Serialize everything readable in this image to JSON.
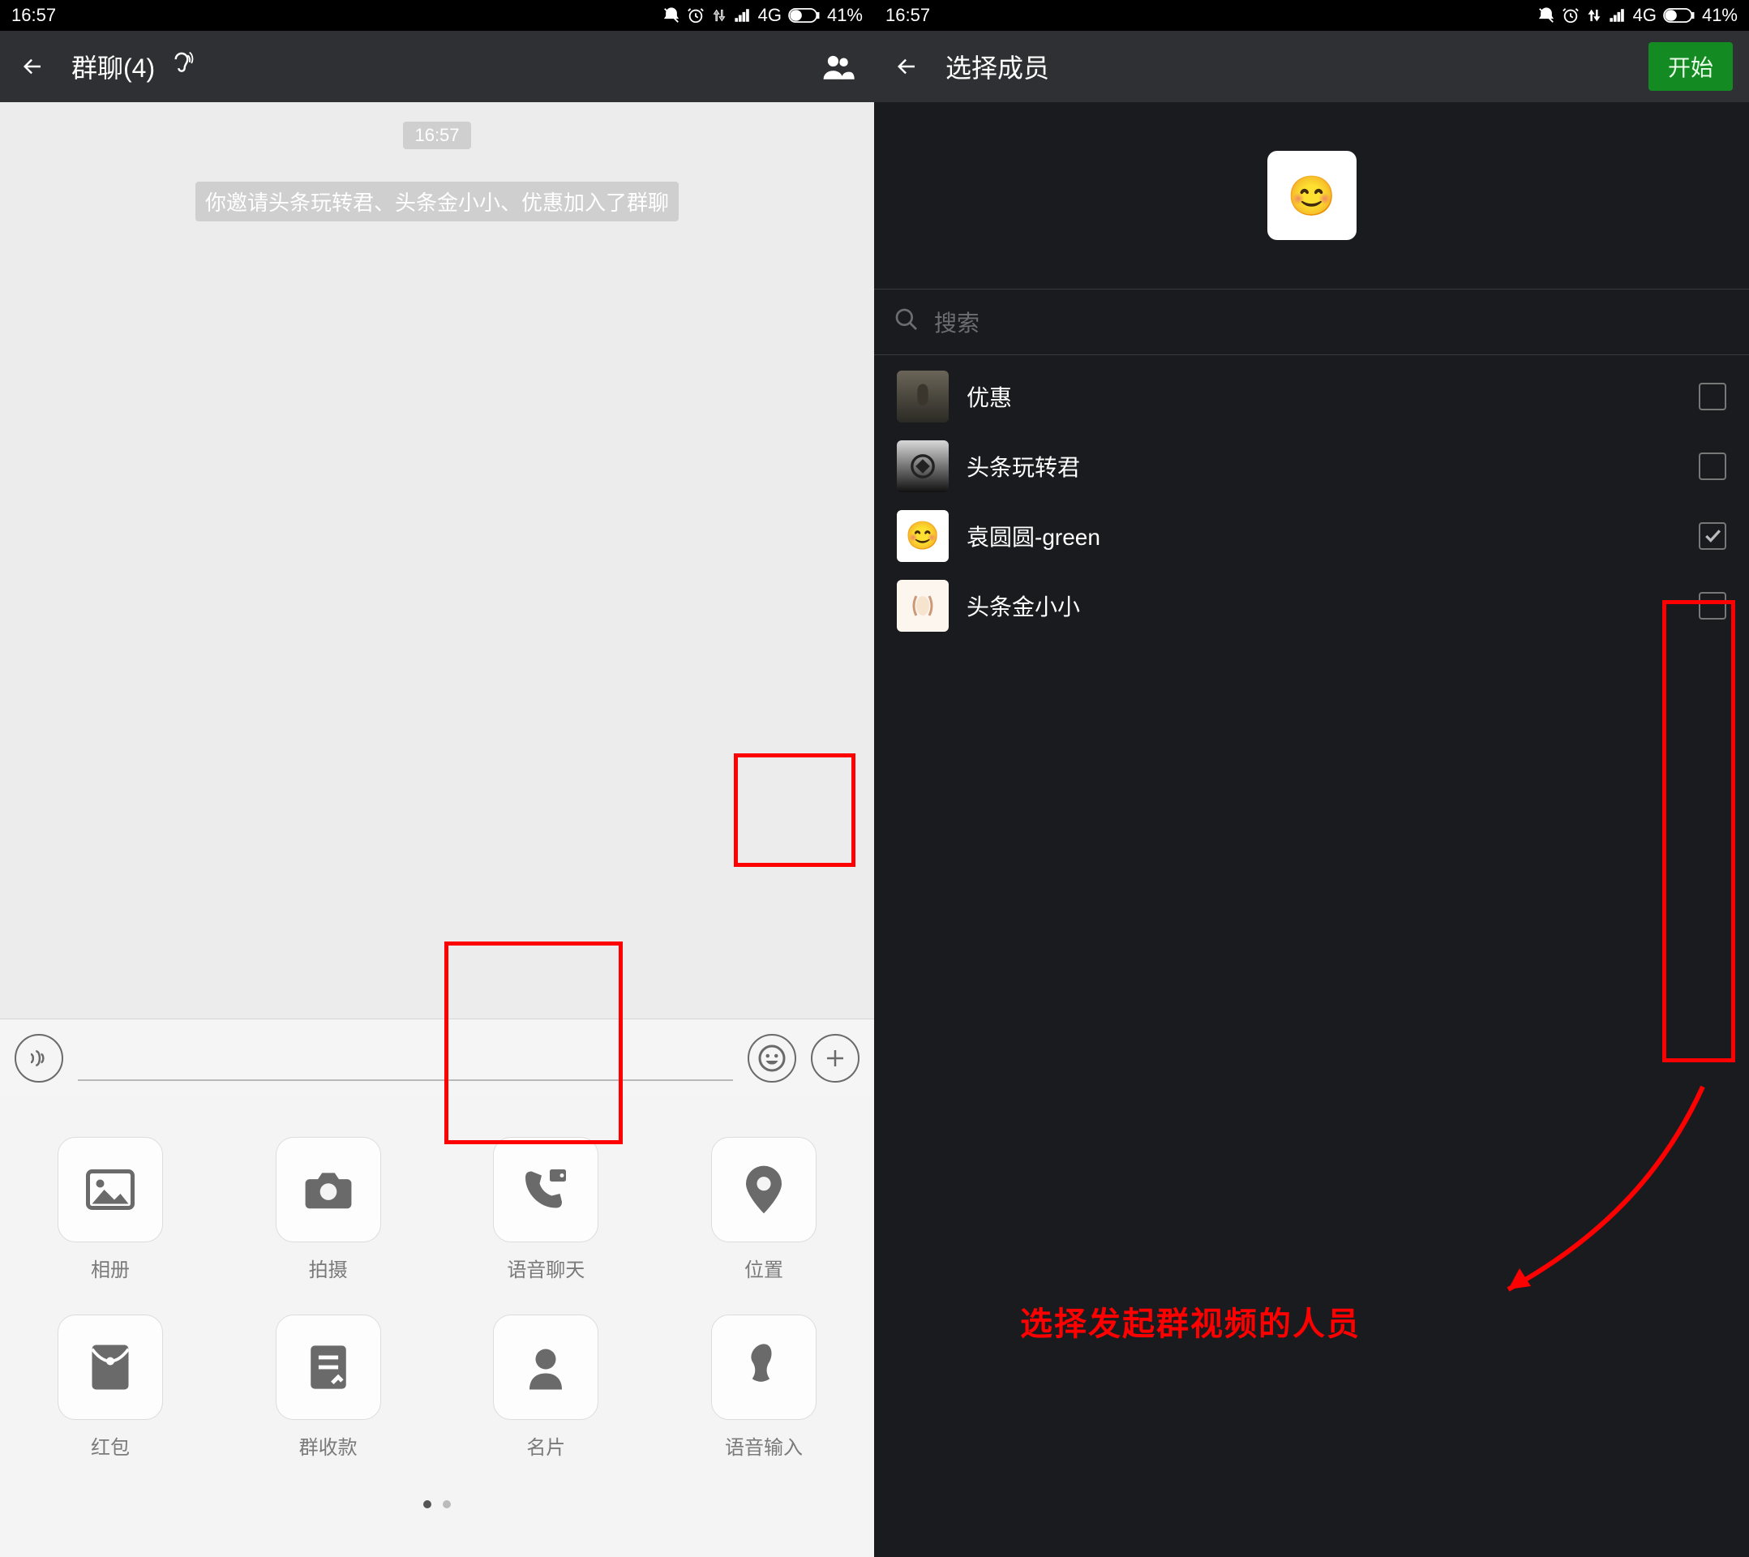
{
  "status": {
    "time": "16:57",
    "network": "4G",
    "battery": "41%"
  },
  "left": {
    "header_title": "群聊(4)",
    "chat_time": "16:57",
    "system_message": "你邀请头条玩转君、头条金小小、优惠加入了群聊",
    "attachments": [
      {
        "label": "相册"
      },
      {
        "label": "拍摄"
      },
      {
        "label": "语音聊天"
      },
      {
        "label": "位置"
      },
      {
        "label": "红包"
      },
      {
        "label": "群收款"
      },
      {
        "label": "名片"
      },
      {
        "label": "语音输入"
      }
    ]
  },
  "right": {
    "header_title": "选择成员",
    "start_label": "开始",
    "search_placeholder": "搜索",
    "members": [
      {
        "name": "优惠",
        "checked": false
      },
      {
        "name": "头条玩转君",
        "checked": false
      },
      {
        "name": "袁圆圆-green",
        "checked": true
      },
      {
        "name": "头条金小小",
        "checked": false
      }
    ]
  },
  "annotation": {
    "caption": "选择发起群视频的人员"
  }
}
